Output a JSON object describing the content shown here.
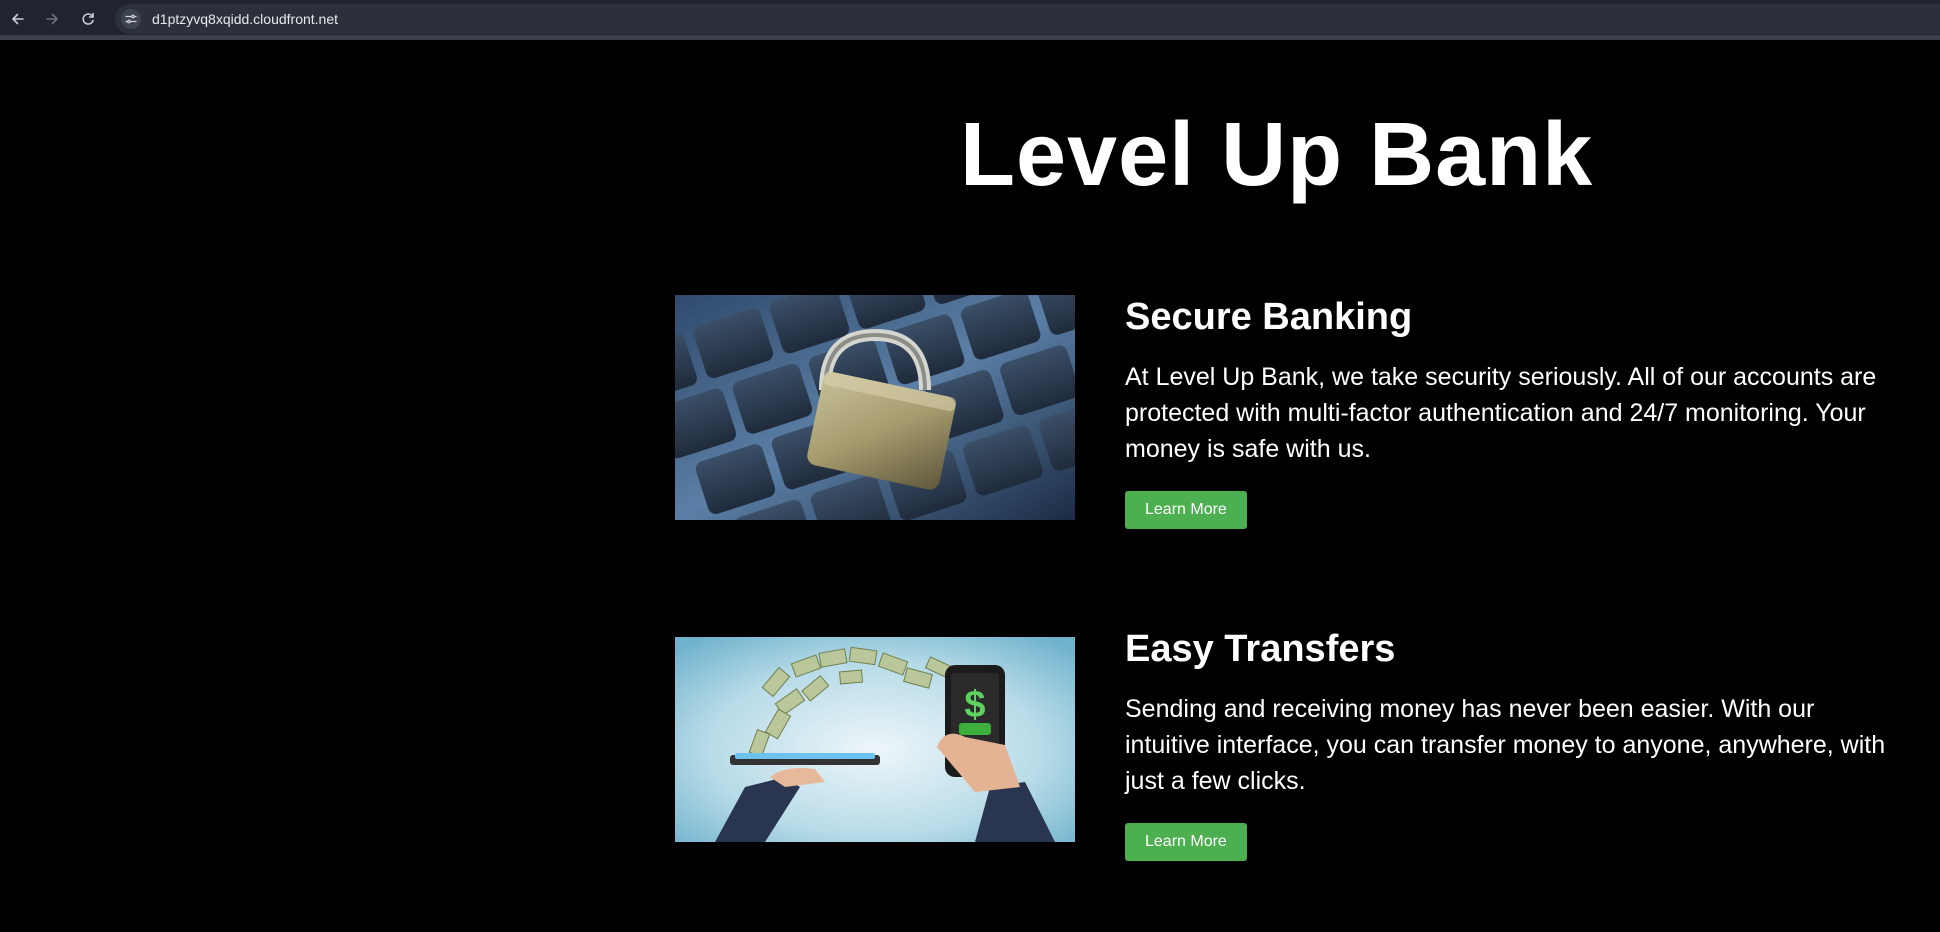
{
  "browser": {
    "url": "d1ptzyvq8xqidd.cloudfront.net"
  },
  "page": {
    "title": "Level Up Bank"
  },
  "features": [
    {
      "heading": "Secure Banking",
      "body": "At Level Up Bank, we take security seriously. All of our accounts are protected with multi-factor authentication and 24/7 monitoring. Your money is safe with us.",
      "button": "Learn More",
      "image": "padlock-on-keyboard-photo"
    },
    {
      "heading": "Easy Transfers",
      "body": "Sending and receiving money has never been easier. With our intuitive interface, you can transfer money to anyone, anywhere, with just a few clicks.",
      "button": "Learn More",
      "image": "money-transfer-phones-photo"
    }
  ],
  "colors": {
    "background": "#000000",
    "button": "#4caf50",
    "chrome": "#1f2430"
  }
}
